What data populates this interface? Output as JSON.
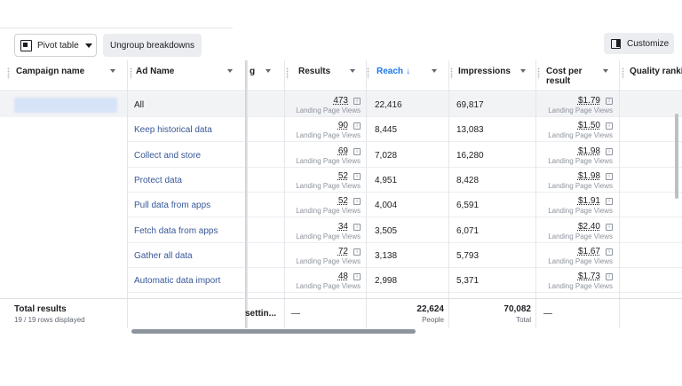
{
  "toolbar": {
    "pivot_label": "Pivot table",
    "ungroup_label": "Ungroup breakdowns",
    "customize_label": "Customize"
  },
  "columns": {
    "campaign_name": "Campaign name",
    "ad_name": "Ad Name",
    "truncated": "g",
    "results": "Results",
    "reach": "Reach",
    "reach_sort": "↓",
    "impressions": "Impressions",
    "cost_per_result": "Cost per result",
    "quality_ranking": "Quality rankin"
  },
  "result_type": "Landing Page Views",
  "info_glyph": "i",
  "rows": [
    {
      "ad_name": "All",
      "results": "473",
      "reach": "22,416",
      "impressions": "69,817",
      "cost": "$1.79"
    },
    {
      "ad_name": "Keep historical data",
      "results": "90",
      "reach": "8,445",
      "impressions": "13,083",
      "cost": "$1.50"
    },
    {
      "ad_name": "Collect and store",
      "results": "69",
      "reach": "7,028",
      "impressions": "16,280",
      "cost": "$1.98"
    },
    {
      "ad_name": "Protect data",
      "results": "52",
      "reach": "4,951",
      "impressions": "8,428",
      "cost": "$1.98"
    },
    {
      "ad_name": "Pull data from apps",
      "results": "52",
      "reach": "4,004",
      "impressions": "6,591",
      "cost": "$1.91"
    },
    {
      "ad_name": "Fetch data from apps",
      "results": "34",
      "reach": "3,505",
      "impressions": "6,071",
      "cost": "$2.40"
    },
    {
      "ad_name": "Gather all data",
      "results": "72",
      "reach": "3,138",
      "impressions": "5,793",
      "cost": "$1.67"
    },
    {
      "ad_name": "Automatic data import",
      "results": "48",
      "reach": "2,998",
      "impressions": "5,371",
      "cost": "$1.73"
    }
  ],
  "footer": {
    "total_label": "Total results",
    "rows_displayed": "19 / 19 rows displayed",
    "truncated_setting": "settin...",
    "results_total": "—",
    "reach_total": "22,624",
    "reach_sub": "People",
    "impressions_total": "70,082",
    "impressions_sub": "Total",
    "cost_total": "—"
  },
  "colors": {
    "link": "#385898",
    "sort_active": "#1877f2",
    "muted": "#8d949e"
  }
}
